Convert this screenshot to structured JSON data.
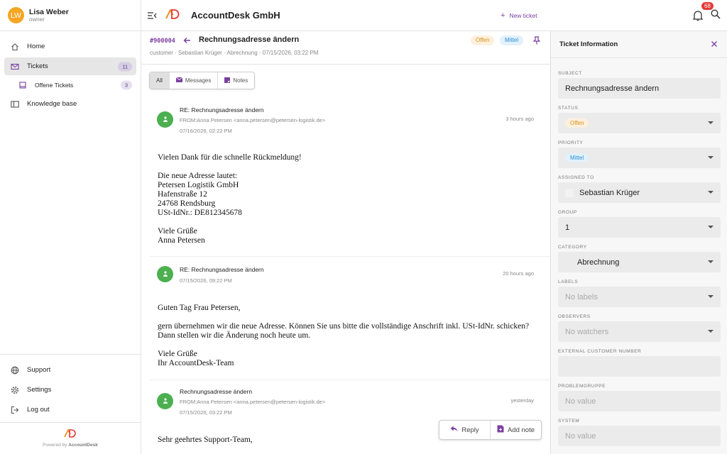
{
  "user": {
    "initials": "LW",
    "name": "Lisa Weber",
    "role": "owner"
  },
  "nav": {
    "home": "Home",
    "tickets": "Tickets",
    "tickets_count": "11",
    "open_tickets": "Offene Tickets",
    "open_tickets_count": "3",
    "knowledge_base": "Knowledge base",
    "support": "Support",
    "settings": "Settings",
    "logout": "Log out"
  },
  "footer": {
    "powered_by": "Powered by",
    "brand": "AccountDesk"
  },
  "header": {
    "company": "AccountDesk GmbH",
    "new_ticket": "New ticket",
    "notifications": "68"
  },
  "ticket": {
    "id": "#900004",
    "title": "Rechnungsadresse ändern",
    "meta": "customer · Sebastian Krüger · Abrechnung · 07/15/2026, 03:22 PM",
    "status": "Offen",
    "priority": "Mittel"
  },
  "filters": {
    "all": "All",
    "messages": "Messages",
    "notes": "Notes"
  },
  "messages": [
    {
      "subject": "RE: Rechnungsadresse ändern",
      "from": "FROM:Anna Petersen <anna.petersen@petersen-logistik.de>",
      "date": "07/16/2026, 02:22 PM",
      "ago": "3 hours ago",
      "body": "Vielen Dank für die schnelle Rückmeldung!\n\nDie neue Adresse lautet:\nPetersen Logistik GmbH\nHafenstraße 12\n24768 Rendsburg\nUSt-IdNr.: DE812345678\n\nViele Grüße\nAnna Petersen"
    },
    {
      "subject": "RE: Rechnungsadresse ändern",
      "from": "",
      "date": "07/15/2026, 09:22 PM",
      "ago": "20 hours ago",
      "body": "Guten Tag Frau Petersen,\n\ngern übernehmen wir die neue Adresse. Können Sie uns bitte die vollständige Anschrift inkl. USt-IdNr. schicken?\nDann stellen wir die Änderung noch heute um.\n\nViele Grüße\nIhr AccountDesk-Team"
    },
    {
      "subject": "Rechnungsadresse ändern",
      "from": "FROM:Anna Petersen <anna.petersen@petersen-logistik.de>",
      "date": "07/15/2026, 03:22 PM",
      "ago": "yesterday",
      "body": "Sehr geehrtes Support-Team,"
    }
  ],
  "actions": {
    "reply": "Reply",
    "add_note": "Add note"
  },
  "panel": {
    "title": "Ticket Information",
    "subject_label": "SUBJECT",
    "subject_value": "Rechnungsadresse ändern",
    "status_label": "STATUS",
    "status_value": "Offen",
    "priority_label": "PRIORITY",
    "priority_value": "Mittel",
    "assigned_label": "ASSIGNED TO",
    "assigned_value": "Sebastian Krüger",
    "group_label": "GROUP",
    "group_value": "1",
    "category_label": "CATEGORY",
    "category_value": "Abrechnung",
    "labels_label": "LABELS",
    "labels_value": "No labels",
    "observers_label": "OBSERVERS",
    "observers_value": "No watchers",
    "ext_label": "EXTERNAL CUSTOMER NUMBER",
    "ext_value": "",
    "problem_label": "PROBLEMGRUPPE",
    "problem_value": "No value",
    "system_label": "SYSTEM",
    "system_value": "No value"
  },
  "colors": {
    "accent": "#7b3fa0",
    "avatar": "#f5a623",
    "message_avatar": "#4caf50",
    "notification": "#e53935"
  }
}
